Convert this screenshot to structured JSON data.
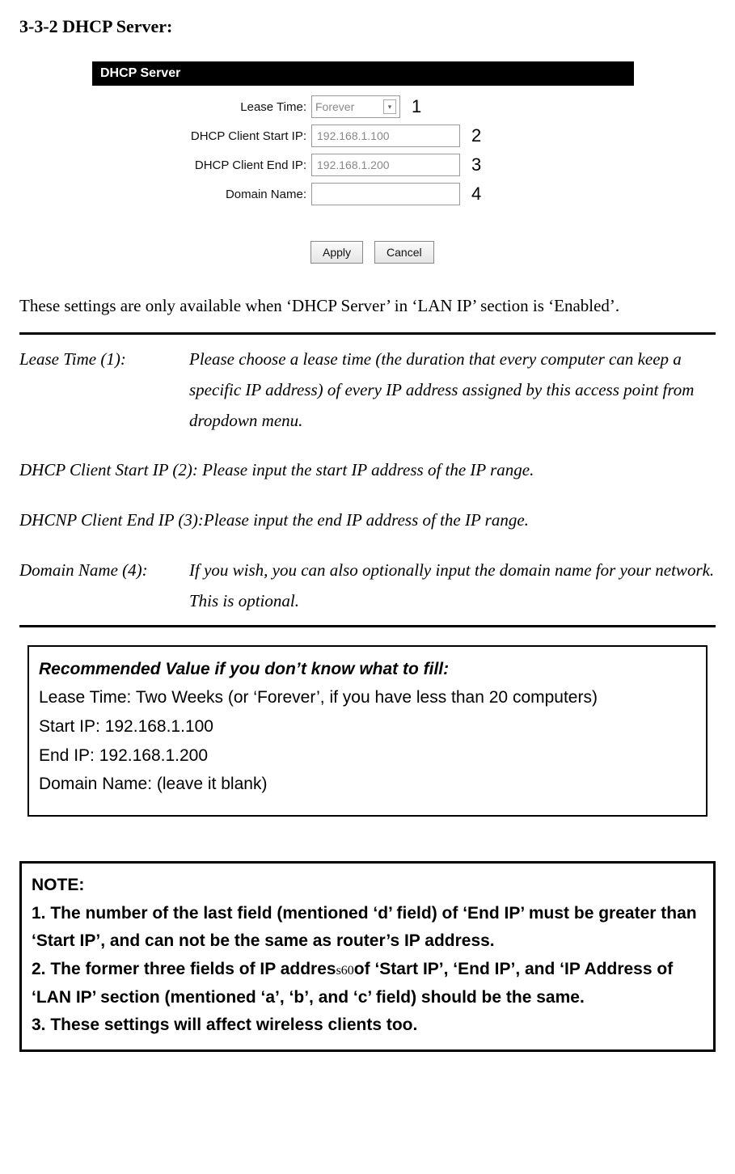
{
  "heading": "3-3-2 DHCP Server:",
  "form": {
    "banner": "DHCP Server",
    "rows": [
      {
        "label": "Lease Time:",
        "value": "Forever",
        "callout": "1",
        "type": "select"
      },
      {
        "label": "DHCP Client Start IP:",
        "value": "192.168.1.100",
        "callout": "2",
        "type": "text"
      },
      {
        "label": "DHCP Client End IP:",
        "value": "192.168.1.200",
        "callout": "3",
        "type": "text"
      },
      {
        "label": "Domain Name:",
        "value": "",
        "callout": "4",
        "type": "text"
      }
    ],
    "buttons": {
      "apply": "Apply",
      "cancel": "Cancel"
    }
  },
  "intro": "These settings are only available when ‘DHCP Server’ in ‘LAN IP’ section is ‘Enabled’.",
  "defs": {
    "d1_label": "Lease Time (1):",
    "d1_text": "Please choose a lease time (the duration that every computer can keep a specific IP address) of every IP address assigned by this access point from dropdown menu.",
    "d2": "DHCP Client Start IP (2): Please input the start IP address of the IP range.",
    "d3": "DHCNP Client End IP (3):Please input the end IP address of the IP range.",
    "d4_label": "Domain Name (4):",
    "d4_text": "If you wish, you can also optionally input the domain name for your network. This is optional."
  },
  "rec": {
    "title": "Recommended Value if you don’t know what to fill:",
    "l1": "Lease Time: Two Weeks (or ‘Forever’, if you have less than 20 computers)",
    "l2": "Start IP: 192.168.1.100",
    "l3": "End IP: 192.168.1.200",
    "l4": "Domain Name: (leave it blank)"
  },
  "note": {
    "title": "NOTE:",
    "n1": "1. The number of the last field (mentioned ‘d’ field) of ‘End IP’ must be greater than ‘Start IP’, and can not be the same as router’s IP address.",
    "n2a": "2. The former three fields of IP addres",
    "n2b": "of ‘Start IP’, ‘End IP’, and ‘IP Address of ‘LAN IP’ section (mentioned ‘a’, ‘b’, and ‘c’ field) should be the same.",
    "n3": "3. These settings will affect wireless clients too.",
    "page_prefix": "s",
    "page_num": "60"
  }
}
